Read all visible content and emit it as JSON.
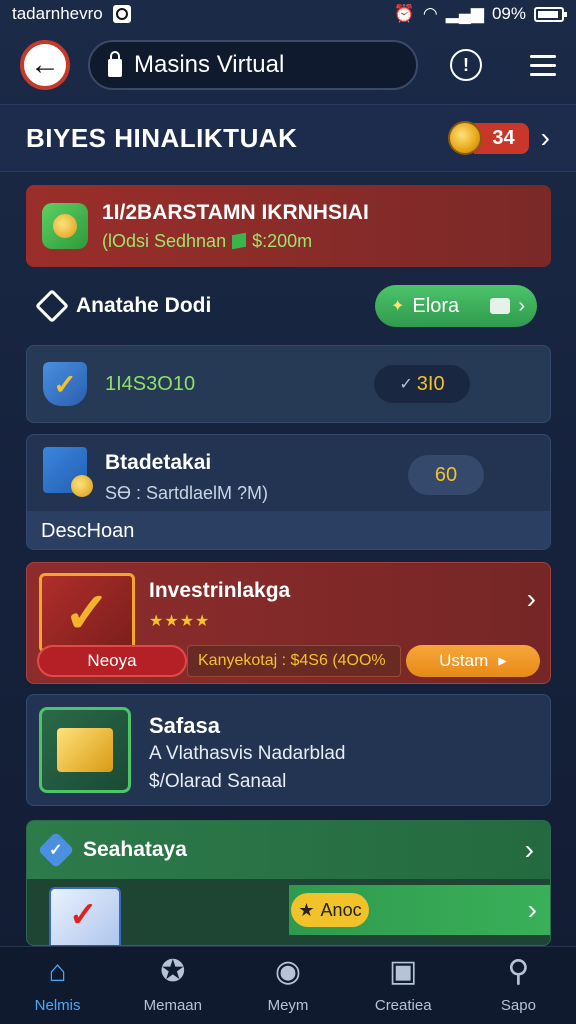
{
  "status_bar": {
    "left_text": "tadarnhevro",
    "battery": "09%"
  },
  "toolbar": {
    "url": "Masins Virtual",
    "info_label": "!"
  },
  "header": {
    "title": "BIYES HINALIKTUAK",
    "coins": "34"
  },
  "cards": {
    "promo": {
      "title": "1I/2BARSTAMN IKRNHSIAI",
      "subtitle": "(lOdsi Sedhnan",
      "amount": "$:200m"
    },
    "row": {
      "label": "Anatahe Dodi",
      "button": "Elora"
    },
    "balance": {
      "value": "1I4S3O10",
      "pill": "3I0"
    },
    "details": {
      "title": "Btadetakai",
      "subtitle": "SӨ : SartdlaelM ?M)",
      "pill": "60",
      "footer": "DescHoan"
    },
    "invest": {
      "title": "Investrinlakga",
      "stars": "★★★★",
      "left_btn": "Neoya",
      "chip": "Kanyekotaj : $4S6 (4OO%",
      "right_btn": "Ustam"
    },
    "safasa": {
      "title": "Safasa",
      "line1": "A Vlathasvis Nadarblad",
      "line2": "$/Olarad Sanaal"
    },
    "green": {
      "title": "Seahataya",
      "tag": "Anoc"
    }
  },
  "nav": {
    "items": [
      {
        "label": "Nelmis",
        "icon": "home-icon"
      },
      {
        "label": "Memaan",
        "icon": "star-icon"
      },
      {
        "label": "Meym",
        "icon": "camera-icon"
      },
      {
        "label": "Creatiea",
        "icon": "layers-icon"
      },
      {
        "label": "Sapo",
        "icon": "search-icon"
      }
    ]
  },
  "colors": {
    "accent": "#4aa8ff",
    "red_card": "#8e2c2c",
    "green_button": "#3ab05a",
    "coin_gold": "#f2c22a"
  }
}
